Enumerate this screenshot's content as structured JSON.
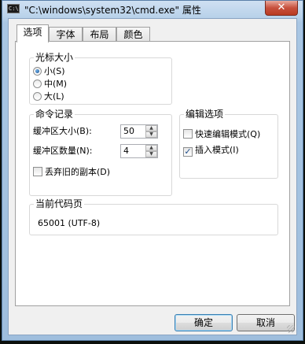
{
  "window": {
    "title": "\"C:\\windows\\system32\\cmd.exe\" 属性",
    "close_label": "✕",
    "app_icon_text": "C:\\"
  },
  "tabs": [
    {
      "label": "选项",
      "active": true
    },
    {
      "label": "字体",
      "active": false
    },
    {
      "label": "布局",
      "active": false
    },
    {
      "label": "颜色",
      "active": false
    }
  ],
  "cursor_size": {
    "title": "光标大小",
    "options": [
      {
        "label": "小(S)",
        "selected": true
      },
      {
        "label": "中(M)",
        "selected": false
      },
      {
        "label": "大(L)",
        "selected": false
      }
    ]
  },
  "command_history": {
    "title": "命令记录",
    "buffer_size_label": "缓冲区大小(B):",
    "buffer_size_value": "50",
    "buffer_count_label": "缓冲区数量(N):",
    "buffer_count_value": "4",
    "discard_old_label": "丢弃旧的副本(D)",
    "discard_old_checked": false
  },
  "edit_options": {
    "title": "编辑选项",
    "quick_edit_label": "快速编辑模式(Q)",
    "quick_edit_checked": false,
    "insert_mode_label": "插入模式(I)",
    "insert_mode_checked": true
  },
  "code_page": {
    "title": "当前代码页",
    "value": "65001  (UTF-8)"
  },
  "buttons": {
    "ok": "确定",
    "cancel": "取消"
  }
}
